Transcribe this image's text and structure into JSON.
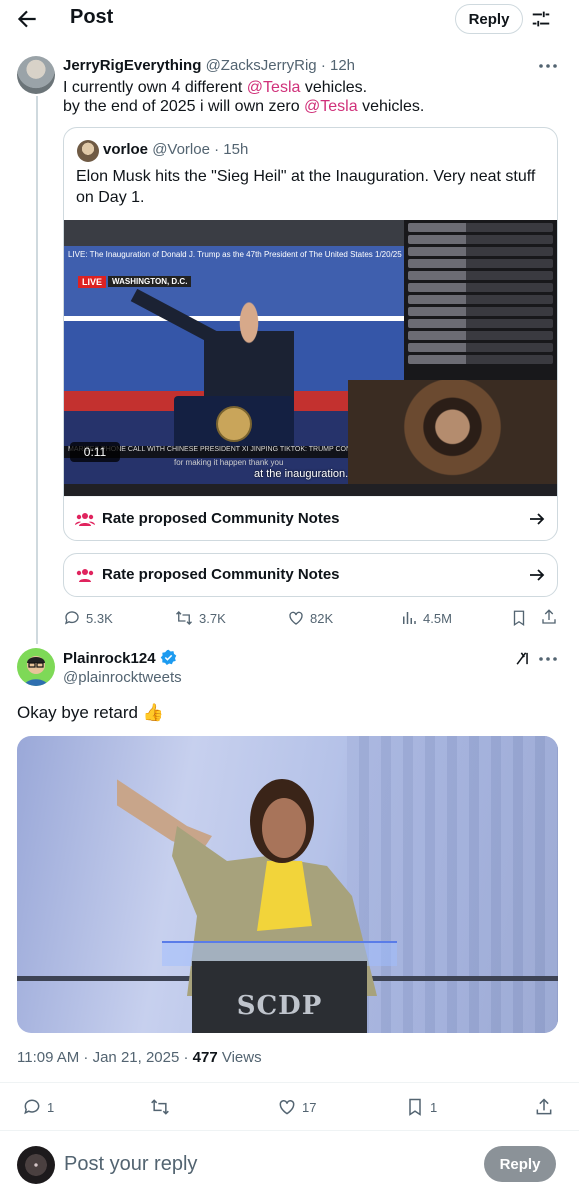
{
  "header": {
    "title": "Post",
    "reply_label": "Reply"
  },
  "parent_tweet": {
    "name": "JerryRigEverything",
    "handle": "@ZacksJerryRig",
    "time": "· 12h",
    "line1_pre": "I currently own 4 different ",
    "line1_mention": "@Tesla",
    "line1_post": " vehicles.",
    "line2_pre": "by the end of 2025 i will own zero ",
    "line2_mention": "@Tesla",
    "line2_post": " vehicles."
  },
  "quoted_tweet": {
    "name": "vorloe",
    "handle": "@Vorloe",
    "time": "· 15h",
    "text": "Elon Musk hits the \"Sieg Heil\" at the Inauguration. Very neat stuff on Day 1.",
    "media": {
      "stream_title": "LIVE: The Inauguration of Donald J. Trump as the 47th President of The United States 1/20/25",
      "live_badge": "LIVE",
      "location": "WASHINGTON, D.C.",
      "ticker": "MARIZES PHONE CALL WITH CHINESE PRESIDENT XI JINPING   TIKTOK: TRUMP CON",
      "caption_small": "for making it happen thank you",
      "caption_big": "at the inauguration.",
      "timecode": "0:11"
    },
    "community_notes_label": "Rate proposed Community Notes"
  },
  "community_notes_label": "Rate proposed Community Notes",
  "parent_actions": {
    "replies": "5.3K",
    "reposts": "3.7K",
    "likes": "82K",
    "views": "4.5M"
  },
  "main_tweet": {
    "name": "Plainrock124",
    "handle": "@plainrocktweets",
    "text": "Okay bye retard 👍",
    "photo_logo": "SCDP",
    "timestamp": "11:09 AM · Jan 21, 2025 · ",
    "views_count": "477",
    "views_label": " Views"
  },
  "main_actions": {
    "replies": "1",
    "likes": "17",
    "bookmarks": "1"
  },
  "reply_bar": {
    "placeholder": "Post your reply",
    "button_label": "Reply"
  },
  "colors": {
    "mention": "#d0317a",
    "verified": "#1d9bf0",
    "community_notes": "#e0245e"
  }
}
